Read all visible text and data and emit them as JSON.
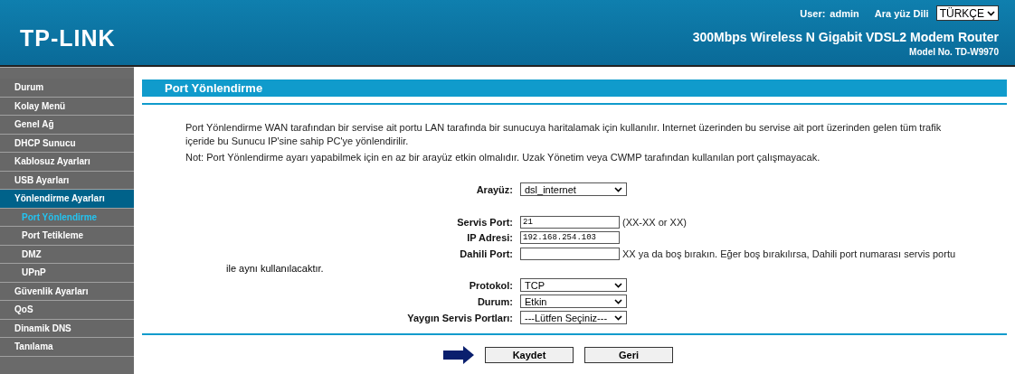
{
  "header": {
    "logo": "TP-LINK",
    "user_label": "User:",
    "user": "admin",
    "language_label": "Ara yüz Dili",
    "language": "TÜRKÇE",
    "product": "300Mbps Wireless N Gigabit VDSL2 Modem Router",
    "model": "Model No. TD-W9970"
  },
  "sidebar": [
    {
      "label": "Durum",
      "selected": false
    },
    {
      "label": "Kolay Menü",
      "selected": false
    },
    {
      "label": "Genel Ağ",
      "selected": false
    },
    {
      "label": "DHCP Sunucu",
      "selected": false
    },
    {
      "label": "Kablosuz Ayarları",
      "selected": false
    },
    {
      "label": "USB Ayarları",
      "selected": false
    },
    {
      "label": "Yönlendirme Ayarları",
      "selected": true,
      "children": [
        {
          "label": "Port Yönlendirme",
          "selected": true
        },
        {
          "label": "Port Tetikleme",
          "selected": false
        },
        {
          "label": "DMZ",
          "selected": false
        },
        {
          "label": "UPnP",
          "selected": false
        }
      ]
    },
    {
      "label": "Güvenlik Ayarları",
      "selected": false
    },
    {
      "label": "QoS",
      "selected": false
    },
    {
      "label": "Dinamik DNS",
      "selected": false
    },
    {
      "label": "Tanılama",
      "selected": false
    }
  ],
  "page_title": "Port Yönlendirme",
  "description": "Port Yönlendirme WAN tarafından bir servise ait portu LAN tarafında bir sunucuya haritalamak için kullanılır. Internet üzerinden bu servise ait port üzerinden gelen tüm trafik içeride bu Sunucu IP'sine sahip PC'ye yönlendirilir.",
  "note": "Not: Port Yönlendirme ayarı yapabilmek için en az bir arayüz etkin olmalıdır. Uzak Yönetim veya CWMP tarafından kullanılan port çalışmayacak.",
  "form": [
    {
      "kind": "select",
      "label": "Arayüz:",
      "value": "dsl_internet"
    },
    {
      "kind": "gap"
    },
    {
      "kind": "input",
      "label": "Servis Port:",
      "value": "21",
      "hint": "(XX-XX or XX)"
    },
    {
      "kind": "input",
      "label": "IP Adresi:",
      "value": "192.168.254.103"
    },
    {
      "kind": "input",
      "label": "Dahili Port:",
      "hint_lines": [
        "XX ya da boş bırakın. Eğer boş bırakılırsa, Dahili port numarası servis portu",
        "ile aynı kullanılacaktır."
      ]
    },
    {
      "kind": "select",
      "label": "Protokol:",
      "value": "TCP"
    },
    {
      "kind": "select",
      "label": "Durum:",
      "value": "Etkin"
    },
    {
      "kind": "select",
      "label": "Yaygın Servis Portları:",
      "value": "---Lütfen Seçiniz---"
    }
  ],
  "buttons": [
    "Kaydet",
    "Geri"
  ]
}
